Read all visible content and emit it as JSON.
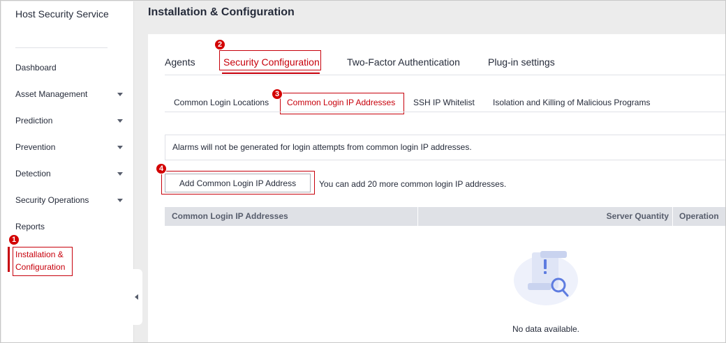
{
  "sidebar": {
    "title": "Host Security Service",
    "items": [
      {
        "label": "Dashboard",
        "has_submenu": false
      },
      {
        "label": "Asset Management",
        "has_submenu": true
      },
      {
        "label": "Prediction",
        "has_submenu": true
      },
      {
        "label": "Prevention",
        "has_submenu": true
      },
      {
        "label": "Detection",
        "has_submenu": true
      },
      {
        "label": "Security Operations",
        "has_submenu": true
      },
      {
        "label": "Reports",
        "has_submenu": false
      }
    ],
    "active_item": {
      "line1": "Installation &",
      "line2": "Configuration"
    }
  },
  "header": {
    "title": "Installation & Configuration"
  },
  "tabs": [
    {
      "label": "Agents",
      "active": false
    },
    {
      "label": "Security Configuration",
      "active": true
    },
    {
      "label": "Two-Factor Authentication",
      "active": false
    },
    {
      "label": "Plug-in settings",
      "active": false
    }
  ],
  "subtabs": [
    {
      "label": "Common Login Locations",
      "active": false
    },
    {
      "label": "Common Login IP Addresses",
      "active": true
    },
    {
      "label": "SSH IP Whitelist",
      "active": false
    },
    {
      "label": "Isolation and Killing of Malicious Programs",
      "active": false
    }
  ],
  "notice": "Alarms will not be generated for login attempts from common login IP addresses.",
  "actions": {
    "add_button_label": "Add Common Login IP Address",
    "quota_text": "You can add 20 more common login IP addresses."
  },
  "table": {
    "columns": [
      "Common Login IP Addresses",
      "Server Quantity",
      "Operation"
    ],
    "rows": [],
    "empty_text": "No data available."
  },
  "callouts": [
    "1",
    "2",
    "3",
    "4"
  ],
  "colors": {
    "accent": "#c7000b",
    "badge": "#d30000",
    "text": "#252b3a",
    "table_header": "#dfe1e6"
  }
}
